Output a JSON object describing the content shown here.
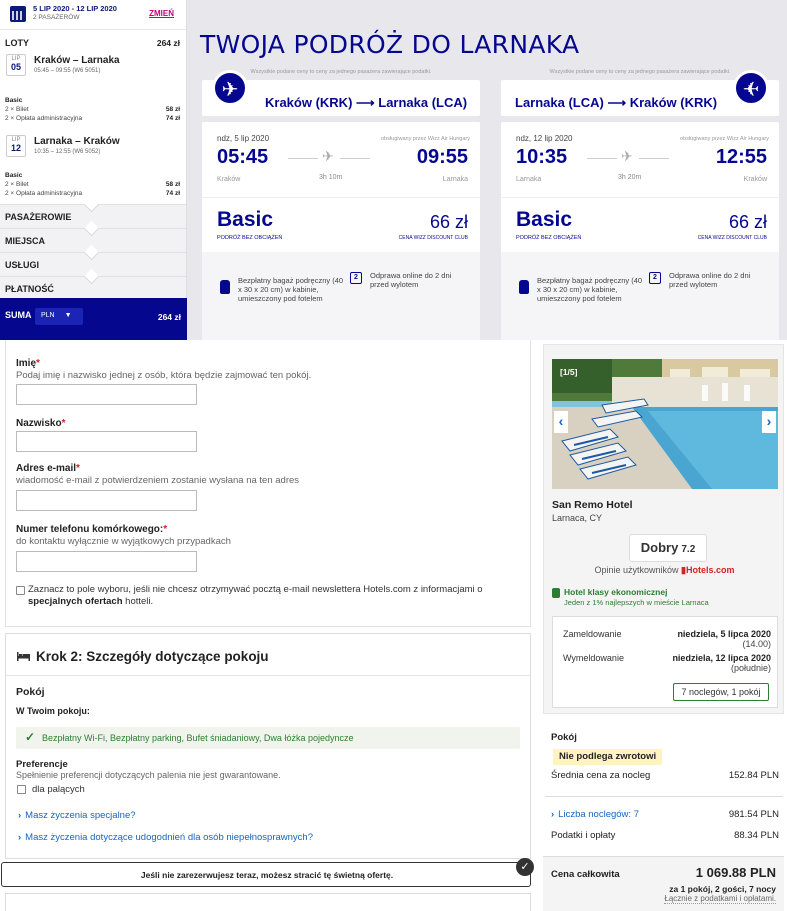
{
  "sidebar": {
    "dates": "5 LIP 2020 - 12 LIP 2020",
    "passengers": "2 PASAŻERÓW",
    "change_label": "ZMIEŃ",
    "flights_label": "LOTY",
    "flights_price": "264 zł",
    "flights": [
      {
        "month": "LIP",
        "day": "05",
        "route": "Kraków – Larnaka",
        "time": "05:45 – 09:55 (W6 5051)",
        "fare_label": "Basic",
        "rows": [
          {
            "label": "2 × Bilet",
            "price": "58 zł"
          },
          {
            "label": "2 × Opłata administracyjna",
            "price": "74 zł"
          }
        ]
      },
      {
        "month": "LIP",
        "day": "12",
        "route": "Larnaka – Kraków",
        "time": "10:35 – 12:55 (W6 5052)",
        "fare_label": "Basic",
        "rows": [
          {
            "label": "2 × Bilet",
            "price": "58 zł"
          },
          {
            "label": "2 × Opłata administracyjna",
            "price": "74 zł"
          }
        ]
      }
    ],
    "sections": [
      "PASAŻEROWIE",
      "MIEJSCA",
      "USŁUGI",
      "PŁATNOŚĆ"
    ],
    "total_label": "SUMA",
    "currency": "PLN",
    "total_price": "264 zł"
  },
  "trip": {
    "title": "TWOJA PODRÓŻ DO LARNAKA",
    "disclaimer": "Wszystkie podane ceny to ceny za jednego pasażera zawierające podatki.",
    "cards": [
      {
        "route": "Kraków (KRK) ⟶ Larnaka (LCA)",
        "date": "ndz, 5 lip 2020",
        "operator": "obsługiwany przez Wizz Air Hungary",
        "dep_time": "05:45",
        "arr_time": "09:55",
        "duration": "3h 10m",
        "from": "Kraków",
        "to": "Larnaka",
        "fare": "Basic",
        "fare_sub": "PODRÓŻ BEZ OBCIĄŻEŃ",
        "price": "66 zł",
        "club": "CENA WIZZ DISCOUNT CLUB",
        "bag": "Bezpłatny bagaż podręczny (40 x 30 x 20 cm) w kabinie, umieszczony pod fotelem",
        "checkin": "Odprawa online do 2 dni przed wylotem"
      },
      {
        "route": "Larnaka (LCA) ⟶ Kraków (KRK)",
        "date": "ndz, 12 lip 2020",
        "operator": "obsługiwany przez Wizz Air Hungary",
        "dep_time": "10:35",
        "arr_time": "12:55",
        "duration": "3h 20m",
        "from": "Larnaka",
        "to": "Kraków",
        "fare": "Basic",
        "fare_sub": "PODRÓŻ BEZ OBCIĄŻEŃ",
        "price": "66 zł",
        "club": "CENA WIZZ DISCOUNT CLUB",
        "bag": "Bezpłatny bagaż podręczny (40 x 30 x 20 cm) w kabinie, umieszczony pod fotelem",
        "checkin": "Odprawa online do 2 dni przed wylotem"
      }
    ]
  },
  "form": {
    "first_name_label": "Imię",
    "first_name_hint": "Podaj imię i nazwisko jednej z osób, która będzie zajmować ten pokój.",
    "first_name_value": "",
    "last_name_label": "Nazwisko",
    "last_name_value": "",
    "email_label": "Adres e-mail",
    "email_hint": "wiadomość e-mail z potwierdzeniem zostanie wysłana na ten adres",
    "email_value": "",
    "phone_label": "Numer telefonu komórkowego:",
    "phone_hint": "do kontaktu wyłącznie w wyjątkowych przypadkach",
    "phone_value": "",
    "required_mark": "*",
    "newsletter_pre": "Zaznacz to pole wyboru, jeśli nie chcesz otrzymywać pocztą e-mail newslettera Hotels.com z informacjami o",
    "newsletter_bold": "specjalnych ofertach",
    "newsletter_post": " hotteli.",
    "step2_title": "Krok 2: Szczegóły dotyczące pokoju",
    "room_label": "Pokój",
    "in_room_label": "W Twoim pokoju:",
    "amenities": "Bezpłatny Wi-Fi, Bezpłatny parking, Bufet śniadaniowy, Dwa łóżka pojedyncze",
    "prefs_label": "Preferencje",
    "prefs_hint": "Spełnienie preferencji dotyczących palenia nie jest gwarantowane.",
    "smokers_label": "dla palących",
    "special_wishes": "Masz życzenia specjalne?",
    "accessibility": "Masz życzenia dotyczące udogodnień dla osób niepełnosprawnych?",
    "alert": "Jeśli nie zarezerwujesz teraz, możesz stracić tę świetną ofertę."
  },
  "hotel": {
    "photo_counter": "[1/5]",
    "name": "San Remo Hotel",
    "location": "Larnaca, CY",
    "rating_word": "Dobry",
    "rating_num": "7.2",
    "reviews_pre": "Opinie użytkowników",
    "reviews_brand": "Hotels.com",
    "eco_title": "Hotel klasy ekonomicznej",
    "eco_sub": "Jeden z 1% najlepszych w mieście Larnaca",
    "checkin_label": "Zameldowanie",
    "checkin_date": "niedziela, 5 lipca 2020",
    "checkin_time": "(14.00)",
    "checkout_label": "Wymeldowanie",
    "checkout_date": "niedziela, 12 lipca 2020",
    "checkout_time": "(południe)",
    "nights_btn": "7 noclegów, 1 pokój",
    "room_label": "Pokój",
    "nonrefundable": "Nie podlega zwrotowi",
    "avg_label": "Średnia cena za nocleg",
    "avg_value": "152.84 PLN",
    "nights_label": "Liczba noclegów: 7",
    "nights_value": "981.54 PLN",
    "tax_label": "Podatki i opłaty",
    "tax_value": "88.34 PLN",
    "total_label": "Cena całkowita",
    "total_value": "1 069.88 PLN",
    "total_sub": "za 1 pokój, 2 gości, 7 nocy",
    "total_sub2": "Łącznie z podatkami i opłatami."
  }
}
